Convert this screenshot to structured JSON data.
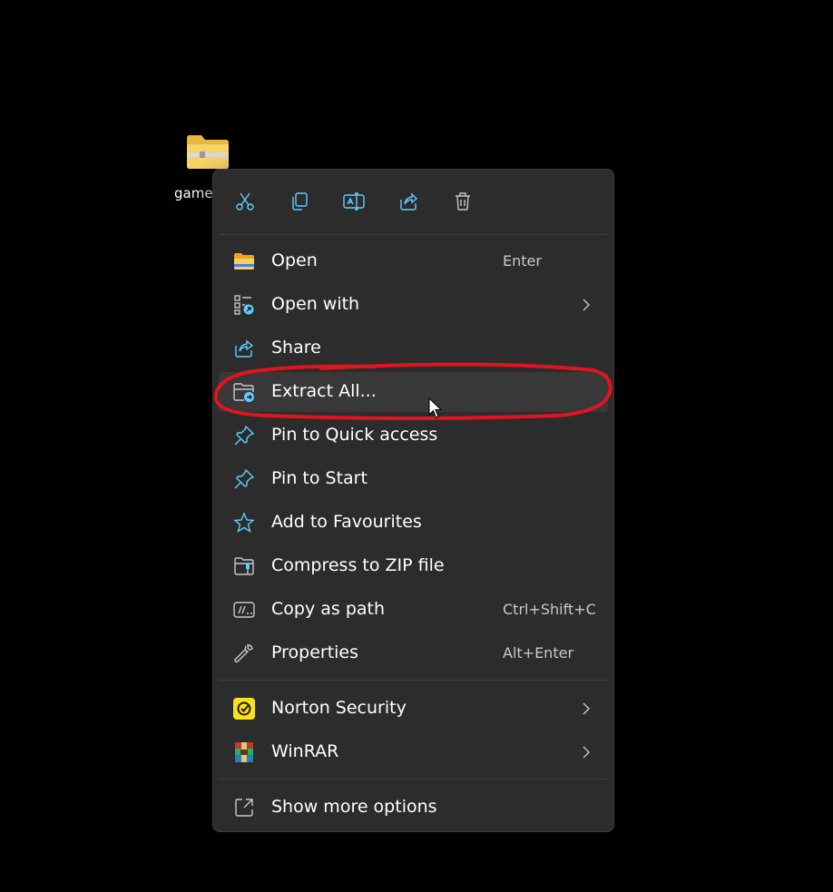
{
  "desktop": {
    "file_label": "game"
  },
  "toolbar": {
    "buttons": [
      {
        "name": "cut",
        "icon": "scissors-icon"
      },
      {
        "name": "copy",
        "icon": "copy-icon"
      },
      {
        "name": "rename",
        "icon": "rename-icon"
      },
      {
        "name": "share",
        "icon": "share-icon"
      },
      {
        "name": "delete",
        "icon": "trash-icon"
      }
    ]
  },
  "menu": {
    "items": [
      {
        "label": "Open",
        "shortcut": "Enter",
        "icon": "folder-icon"
      },
      {
        "label": "Open with",
        "shortcut": "",
        "icon": "open-with-icon",
        "submenu": true
      },
      {
        "label": "Share",
        "shortcut": "",
        "icon": "share-icon"
      },
      {
        "label": "Extract All...",
        "shortcut": "",
        "icon": "extract-folder-icon",
        "highlighted": true
      },
      {
        "label": "Pin to Quick access",
        "shortcut": "",
        "icon": "pin-icon"
      },
      {
        "label": "Pin to Start",
        "shortcut": "",
        "icon": "pin-icon"
      },
      {
        "label": "Add to Favourites",
        "shortcut": "",
        "icon": "star-icon"
      },
      {
        "label": "Compress to ZIP file",
        "shortcut": "",
        "icon": "zip-icon"
      },
      {
        "label": "Copy as path",
        "shortcut": "Ctrl+Shift+C",
        "icon": "copy-path-icon"
      },
      {
        "label": "Properties",
        "shortcut": "Alt+Enter",
        "icon": "wrench-icon"
      }
    ],
    "extensions": [
      {
        "label": "Norton Security",
        "icon": "norton-icon",
        "submenu": true
      },
      {
        "label": "WinRAR",
        "icon": "winrar-icon",
        "submenu": true
      }
    ],
    "footer": {
      "label": "Show more options",
      "icon": "show-more-icon"
    }
  },
  "colors": {
    "menu_bg": "#2c2c2c",
    "hover_bg": "#383838",
    "accent_icon": "#60cdff",
    "annotation": "#e0141e"
  }
}
